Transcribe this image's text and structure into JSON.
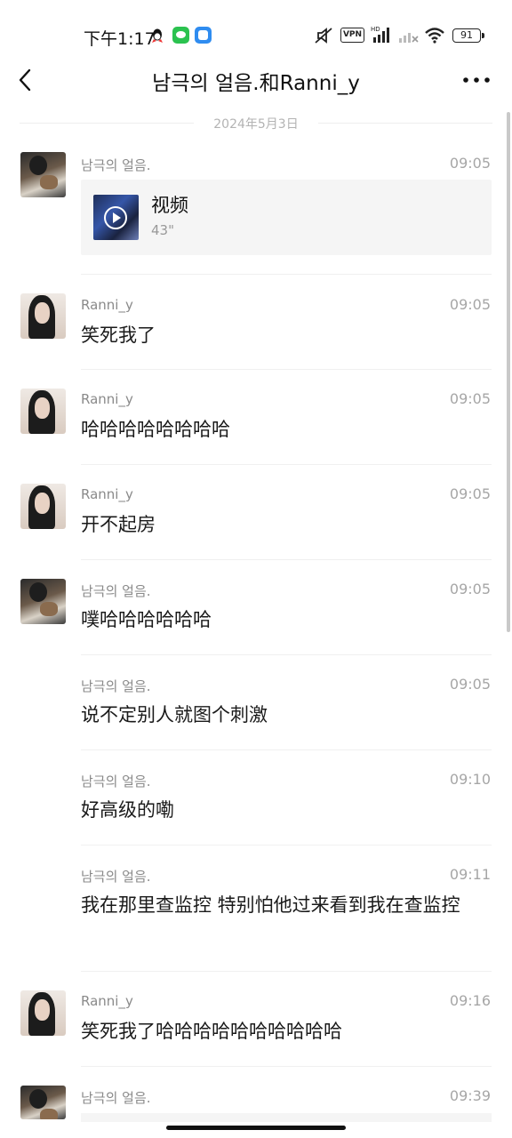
{
  "status_bar": {
    "time": "下午1:17",
    "vpn": "VPN",
    "battery": "91",
    "icons": [
      "qq-icon",
      "wechat-icon",
      "app-icon",
      "mute-icon",
      "signal-icon",
      "signal-icon",
      "wifi-icon",
      "battery-icon"
    ]
  },
  "header": {
    "title": "남극의 얼음.和Ranni_y",
    "back_icon": "chevron-left-icon",
    "more_icon": "more-icon"
  },
  "date_divider": "2024年5月3日",
  "messages": [
    {
      "sender": "남극의 얼음.",
      "time": "09:05",
      "avatar": "nan",
      "type": "video",
      "video_label": "视频",
      "duration": "43\""
    },
    {
      "sender": "Ranni_y",
      "time": "09:05",
      "avatar": "ranni",
      "text": "笑死我了"
    },
    {
      "sender": "Ranni_y",
      "time": "09:05",
      "avatar": "ranni",
      "text": "哈哈哈哈哈哈哈哈"
    },
    {
      "sender": "Ranni_y",
      "time": "09:05",
      "avatar": "ranni",
      "text": "开不起房"
    },
    {
      "sender": "남극의 얼음.",
      "time": "09:05",
      "avatar": "nan",
      "text": "噗哈哈哈哈哈哈"
    },
    {
      "sender": "남극의 얼음.",
      "time": "09:05",
      "text": "说不定别人就图个刺激"
    },
    {
      "sender": "남극의 얼음.",
      "time": "09:10",
      "text": "好高级的嘞"
    },
    {
      "sender": "남극의 얼음.",
      "time": "09:11",
      "text": "我在那里查监控 特别怕他过来看到我在查监控"
    },
    {
      "sender": "Ranni_y",
      "time": "09:16",
      "avatar": "ranni",
      "text": "笑死我了哈哈哈哈哈哈哈哈哈哈"
    },
    {
      "sender": "남극의 얼음.",
      "time": "09:39",
      "avatar": "nan"
    }
  ]
}
